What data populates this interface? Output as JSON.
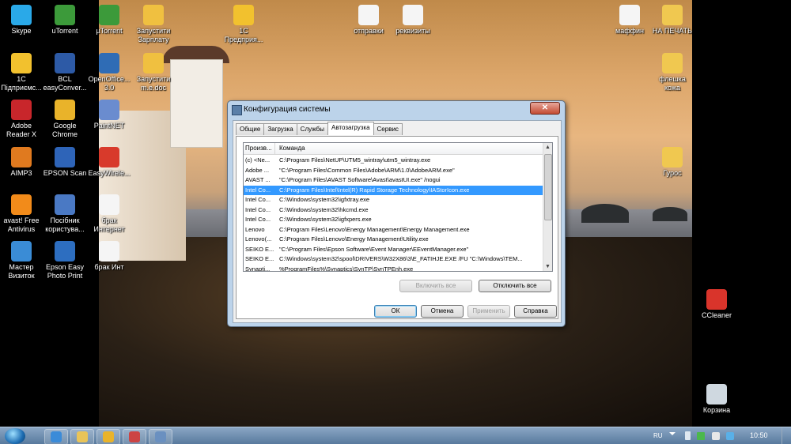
{
  "desktop_icons_left": [
    {
      "label": "Skype",
      "color": "#2aa9e8"
    },
    {
      "label": "uTorrent",
      "color": "#3c9a3a"
    },
    {
      "label": "1С\nПідприємс...",
      "color": "#f2c12e"
    },
    {
      "label": "BCL\neasyConver...",
      "color": "#2d5aa6"
    },
    {
      "label": "Adobe\nReader X",
      "color": "#c8262b"
    },
    {
      "label": "Google\nChrome",
      "color": "#e9b32a"
    },
    {
      "label": "AIMP3",
      "color": "#e07a1f"
    },
    {
      "label": "EPSON Scan",
      "color": "#2e64b8"
    },
    {
      "label": "avast! Free\nAntivirus",
      "color": "#f28b1a"
    },
    {
      "label": "Посібник\nкористува...",
      "color": "#4a79c4"
    },
    {
      "label": "Мастер\nВизиток",
      "color": "#3a8cd6"
    },
    {
      "label": "Epson Easy\nPhoto Print",
      "color": "#2d6ec0"
    }
  ],
  "desktop_icons_mid": [
    {
      "label": "µTorrent",
      "color": "#3c9a3a"
    },
    {
      "label": "Запустити\nЗарплату",
      "color": "#f0c040"
    },
    {
      "label": "OpenOffice...\n3.0",
      "color": "#2f6cb5"
    },
    {
      "label": "Запустити\nm.e.doc",
      "color": "#f0c040"
    },
    {
      "label": "PaintNET",
      "color": "#6a8ccf"
    },
    {
      "label": "EasyWirele...",
      "color": "#d83a2b"
    },
    {
      "label": "брак\nИнтернет",
      "color": "#f5f5f5"
    },
    {
      "label": "брак Инт",
      "color": "#f5f5f5"
    },
    {
      "label": "1С\nПредприя...",
      "color": "#f2c12e"
    },
    {
      "label": "отправки",
      "color": "#f5f5f5"
    },
    {
      "label": "реквизиты",
      "color": "#f5f5f5"
    }
  ],
  "desktop_icons_right": [
    {
      "label": "маффин",
      "color": "#f5f5f5"
    },
    {
      "label": "НА ПЕЧАТЬ",
      "color": "#f0c850"
    },
    {
      "label": "флешка\nкожа",
      "color": "#f0c850"
    },
    {
      "label": "Гурос",
      "color": "#f0c850"
    },
    {
      "label": "CCleaner",
      "color": "#d9342b"
    },
    {
      "label": "Корзина",
      "color": "#cfd8e0"
    }
  ],
  "dialog": {
    "title": "Конфигурация системы",
    "close_label": "✕",
    "tabs": [
      "Общие",
      "Загрузка",
      "Службы",
      "Автозагрузка",
      "Сервис"
    ],
    "active_tab": "Автозагрузка",
    "columns": [
      "Произв...",
      "Команда"
    ],
    "rows": [
      {
        "maker": "(c) <Ne...",
        "command": "C:\\Program Files\\NetUP\\UTM5_wintray\\utm5_wintray.exe",
        "selected": false
      },
      {
        "maker": "Adobe ...",
        "command": "\"C:\\Program Files\\Common Files\\Adobe\\ARM\\1.0\\AdobeARM.exe\"",
        "selected": false
      },
      {
        "maker": "AVAST ...",
        "command": "\"C:\\Program Files\\AVAST Software\\Avast\\avastUI.exe\" /nogui",
        "selected": false
      },
      {
        "maker": "Intel Co...",
        "command": "C:\\Program Files\\Intel\\Intel(R) Rapid Storage Technology\\IAStorIcon.exe",
        "selected": true
      },
      {
        "maker": "Intel Co...",
        "command": "C:\\Windows\\system32\\igfxtray.exe",
        "selected": false
      },
      {
        "maker": "Intel Co...",
        "command": "C:\\Windows\\system32\\hkcmd.exe",
        "selected": false
      },
      {
        "maker": "Intel Co...",
        "command": "C:\\Windows\\system32\\igfxpers.exe",
        "selected": false
      },
      {
        "maker": "Lenovo",
        "command": "C:\\Program Files\\Lenovo\\Energy Management\\Energy Management.exe",
        "selected": false
      },
      {
        "maker": "Lenovo(...",
        "command": "C:\\Program Files\\Lenovo\\Energy Management\\Utility.exe",
        "selected": false
      },
      {
        "maker": "SEIKO E...",
        "command": "\"C:\\Program Files\\Epson Software\\Event Manager\\EEventManager.exe\"",
        "selected": false
      },
      {
        "maker": "SEIKO E...",
        "command": "C:\\Windows\\system32\\spool\\DRIVERS\\W32X86\\3\\E_FATIHJE.EXE /FU \"C:\\Windows\\TEM...",
        "selected": false
      },
      {
        "maker": "Synapti...",
        "command": "%ProgramFiles%\\Synaptics\\SynTP\\SynTPEnh.exe",
        "selected": false
      }
    ],
    "enable_all_label": "Включить все",
    "disable_all_label": "Отключить все",
    "ok_label": "ОК",
    "cancel_label": "Отмена",
    "apply_label": "Применить",
    "help_label": "Справка"
  },
  "taskbar": {
    "language": "RU",
    "clock": "10:50",
    "pinned": [
      {
        "name": "ie",
        "color": "#3b8bd8"
      },
      {
        "name": "explorer",
        "color": "#e9c458"
      },
      {
        "name": "chrome",
        "color": "#e9b32a"
      },
      {
        "name": "app",
        "color": "#c44"
      },
      {
        "name": "msconfig",
        "color": "#6a90c0"
      }
    ]
  }
}
